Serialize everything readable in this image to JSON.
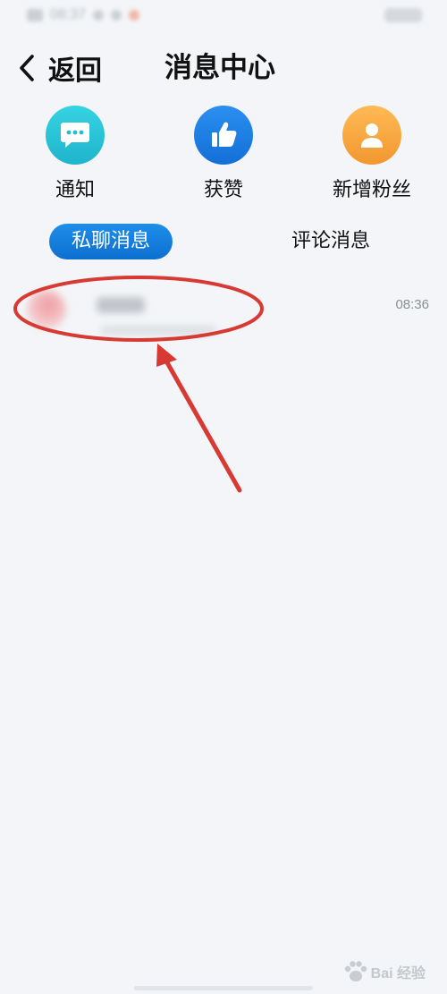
{
  "status_bar": {
    "time": "08:37"
  },
  "header": {
    "back_label": "返回",
    "title": "消息中心"
  },
  "categories": [
    {
      "label": "通知",
      "icon": "chat-bubble-icon",
      "color": "#25c3d6"
    },
    {
      "label": "获赞",
      "icon": "thumbs-up-icon",
      "color": "#1a7ee6"
    },
    {
      "label": "新增粉丝",
      "icon": "person-icon",
      "color": "#f5a340"
    }
  ],
  "tabs": {
    "active": "私聊消息",
    "inactive": "评论消息"
  },
  "messages": [
    {
      "time": "08:36"
    }
  ],
  "colors": {
    "accent": "#1a7ee6",
    "annotation": "#d63a33",
    "background": "#f3f5f8"
  },
  "watermark": {
    "text": "Bai  经验"
  }
}
